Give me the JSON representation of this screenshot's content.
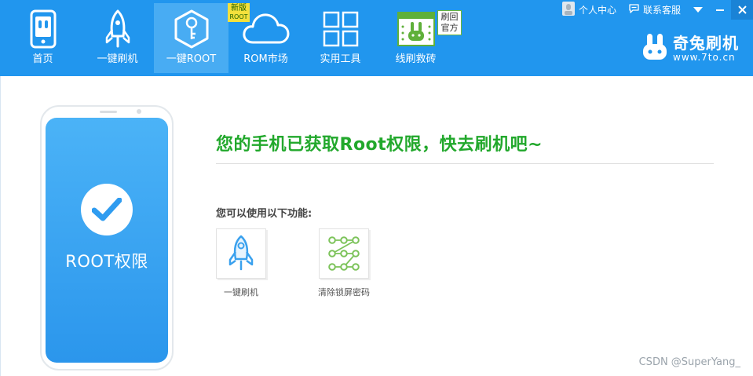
{
  "nav": {
    "items": [
      {
        "label": "首页",
        "icon": "phone-icon"
      },
      {
        "label": "一键刷机",
        "icon": "rocket-icon"
      },
      {
        "label": "一键ROOT",
        "icon": "key-hexagon-icon",
        "active": true
      },
      {
        "label": "ROM市场",
        "icon": "cloud-icon"
      },
      {
        "label": "实用工具",
        "icon": "grid-icon"
      },
      {
        "label": "线刷救砖",
        "icon": "rabbit-board-icon"
      }
    ],
    "new_badge": {
      "line1": "新版",
      "line2": "ROOT"
    },
    "flash_badge": {
      "line1": "刷回",
      "line2": "官方"
    }
  },
  "top_actions": {
    "user_center": "个人中心",
    "contact_service": "联系客服",
    "user_icon": "user-avatar-icon",
    "chat_icon": "chat-bubble-icon"
  },
  "brand": {
    "name": "奇兔刷机",
    "url": "www.7to.cn",
    "logo_icon": "rabbit-logo-icon"
  },
  "main": {
    "phone_text": "ROOT权限",
    "headline": "您的手机已获取Root权限，快去刷机吧~",
    "subhead": "您可以使用以下功能:",
    "functions": [
      {
        "label": "一键刷机",
        "icon": "rocket-icon"
      },
      {
        "label": "清除锁屏密码",
        "icon": "pattern-lock-icon"
      }
    ]
  },
  "watermark": "CSDN @SuperYang_",
  "colors": {
    "topbar": "#2196ee",
    "active_tab": "#48acf3",
    "headline_green": "#22a82c",
    "icon_blue": "#3aa1ee",
    "pattern_green": "#7cc35a"
  }
}
